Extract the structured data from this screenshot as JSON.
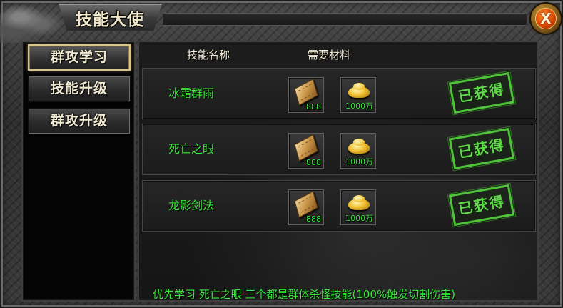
{
  "window": {
    "title": "技能大使",
    "close_label": "X"
  },
  "sidebar": {
    "tabs": [
      {
        "label": "群攻学习",
        "active": true
      },
      {
        "label": "技能升级",
        "active": false
      },
      {
        "label": "群攻升级",
        "active": false
      }
    ]
  },
  "table": {
    "headers": {
      "skill_name": "技能名称",
      "materials": "需要材料"
    },
    "rows": [
      {
        "name": "冰霜群雨",
        "book_qty": "888",
        "gold_qty": "1000万",
        "status": "已获得"
      },
      {
        "name": "死亡之眼",
        "book_qty": "888",
        "gold_qty": "1000万",
        "status": "已获得"
      },
      {
        "name": "龙影剑法",
        "book_qty": "888",
        "gold_qty": "1000万",
        "status": "已获得"
      }
    ]
  },
  "footer": {
    "note": "优先学习 死亡之眼 三个都是群体杀怪技能(100%触发切割伤害)"
  },
  "colors": {
    "accent_green": "#38e83a",
    "stamp_green": "#4fc43a",
    "title_text": "#f0e6c8",
    "close_orange": "#d44400"
  },
  "icons": {
    "book": "skill-book-icon",
    "gold": "gold-ingot-icon"
  }
}
